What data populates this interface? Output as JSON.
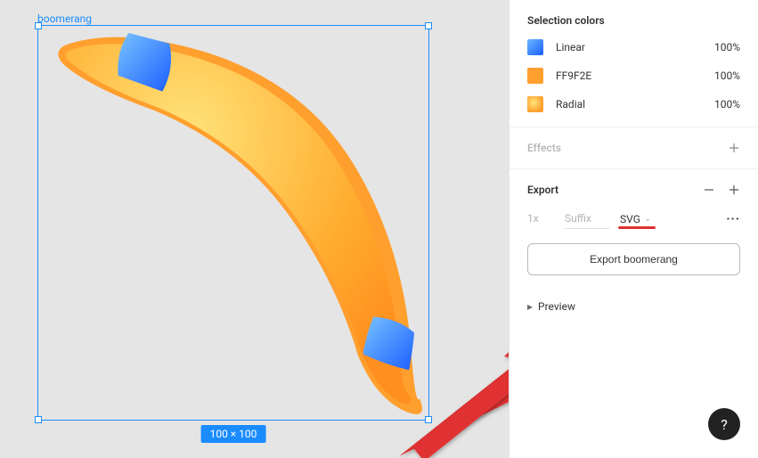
{
  "canvas": {
    "selection_label": "boomerang",
    "dimensions_label": "100 × 100"
  },
  "panels": {
    "selection_colors": {
      "title": "Selection colors",
      "items": [
        {
          "name": "Linear",
          "opacity": "100%"
        },
        {
          "name": "FF9F2E",
          "opacity": "100%"
        },
        {
          "name": "Radial",
          "opacity": "100%"
        }
      ]
    },
    "effects": {
      "title": "Effects"
    },
    "export": {
      "title": "Export",
      "scale": "1x",
      "suffix_placeholder": "Suffix",
      "format": "SVG",
      "button_label": "Export boomerang",
      "preview_label": "Preview"
    }
  },
  "help": {
    "label": "?"
  }
}
